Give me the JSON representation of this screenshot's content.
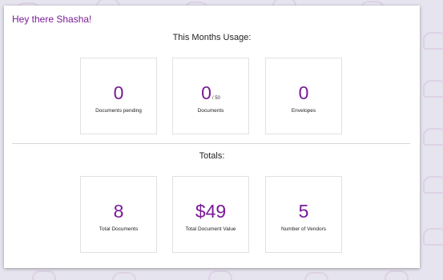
{
  "greeting": "Hey there Shasha!",
  "usage": {
    "title": "This Months Usage:",
    "cards": [
      {
        "value": "0",
        "suffix": "",
        "label": "Documents pending"
      },
      {
        "value": "0",
        "suffix": "/ 50",
        "label": "Documents"
      },
      {
        "value": "0",
        "suffix": "",
        "label": "Envelopes"
      }
    ]
  },
  "totals": {
    "title": "Totals:",
    "cards": [
      {
        "value": "8",
        "label": "Total Documents"
      },
      {
        "value": "$49",
        "label": "Total Document Value"
      },
      {
        "value": "5",
        "label": "Number of Vendors"
      }
    ]
  },
  "colors": {
    "accent": "#7a1a97",
    "background": "#e6e4ee"
  }
}
